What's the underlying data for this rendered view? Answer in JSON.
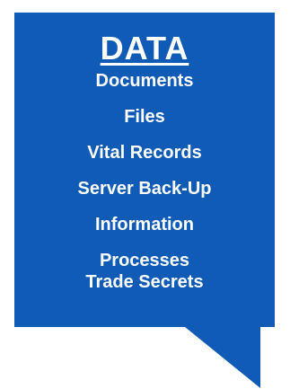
{
  "callout": {
    "title": "DATA",
    "items": [
      "Documents",
      "Files",
      "Vital Records",
      "Server Back-Up",
      "Information",
      "Processes",
      "Trade Secrets"
    ],
    "fill_color": "#0f5bb6",
    "text_color": "#ffffff"
  }
}
